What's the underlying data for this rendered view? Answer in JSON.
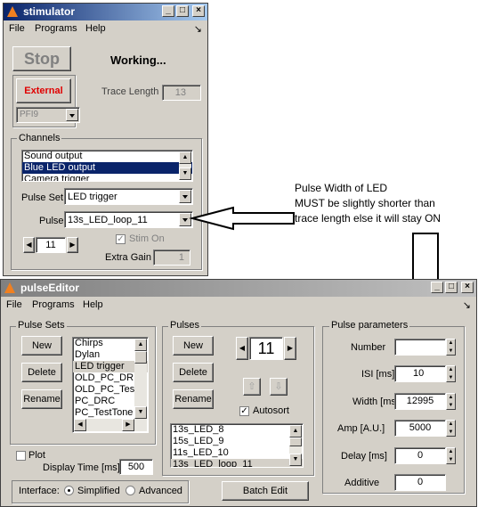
{
  "stimulator": {
    "title": "stimulator",
    "menu": [
      "File",
      "Programs",
      "Help"
    ],
    "stop_label": "Stop",
    "status": "Working...",
    "external_label": "External",
    "trace_length_label": "Trace Length",
    "trace_length_value": "13",
    "pfi_value": "PFI9",
    "channels_label": "Channels",
    "channels": [
      "Sound output",
      "Blue LED output",
      "Camera trigger"
    ],
    "pulse_set_label": "Pulse Set",
    "pulse_set_value": "LED trigger",
    "pulse_label": "Pulse",
    "pulse_value": "13s_LED_loop_11",
    "counter_value": "11",
    "stim_on_label": "Stim On",
    "extra_gain_label": "Extra Gain",
    "extra_gain_value": "1"
  },
  "pulse_editor": {
    "title": "pulseEditor",
    "menu": [
      "File",
      "Programs",
      "Help"
    ],
    "pulse_sets_label": "Pulse Sets",
    "new_label": "New",
    "delete_label": "Delete",
    "rename_label": "Rename",
    "pulse_sets": [
      "Chirps",
      "Dylan",
      "LED trigger",
      "OLD_PC_DR",
      "OLD_PC_Tes",
      "PC_DRC",
      "PC_TestTone"
    ],
    "plot_label": "Plot",
    "display_time_label": "Display Time [ms]",
    "display_time_value": "500",
    "pulses_label": "Pulses",
    "pulses_counter": "11",
    "autosort_label": "Autosort",
    "pulses": [
      "13s_LED_8",
      "15s_LED_9",
      "11s_LED_10",
      "13s_LED_loop_11"
    ],
    "pulse_params_label": "Pulse parameters",
    "params": [
      {
        "label": "Number",
        "value": ""
      },
      {
        "label": "ISI [ms]",
        "value": "10"
      },
      {
        "label": "Width [ms]",
        "value": "12995"
      },
      {
        "label": "Amp [A.U.]",
        "value": "5000"
      },
      {
        "label": "Delay [ms]",
        "value": "0"
      },
      {
        "label": "Additive",
        "value": "0"
      }
    ],
    "interface_label": "Interface:",
    "simplified_label": "Simplified",
    "advanced_label": "Advanced",
    "batch_edit_label": "Batch Edit"
  },
  "annotation": {
    "line1": "Pulse Width of LED",
    "line2": "MUST be slightly shorter than",
    "line3": "trace length else it will stay ON"
  }
}
